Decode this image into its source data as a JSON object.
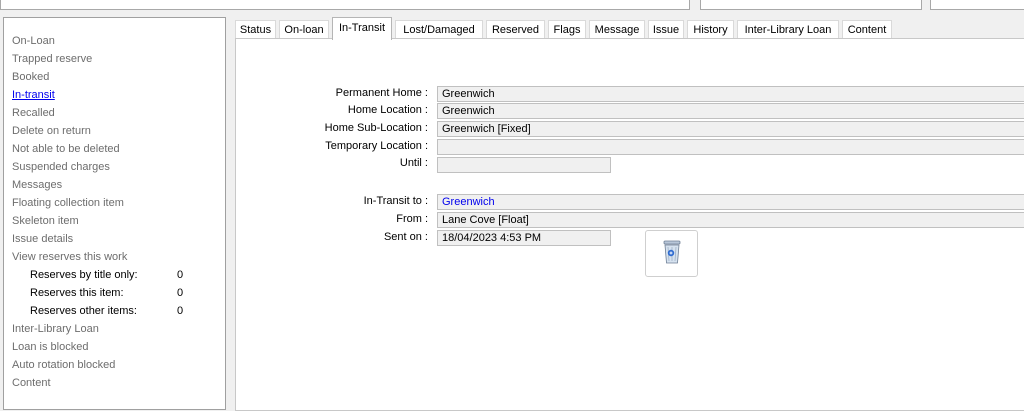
{
  "left_panel": {
    "items": [
      {
        "label": "On-Loan",
        "active": false
      },
      {
        "label": "Trapped reserve",
        "active": false
      },
      {
        "label": "Booked",
        "active": false
      },
      {
        "label": "In-transit",
        "active": true
      },
      {
        "label": "Recalled",
        "active": false
      },
      {
        "label": "Delete on return",
        "active": false
      },
      {
        "label": "Not able to be deleted",
        "active": false
      },
      {
        "label": "Suspended charges",
        "active": false
      },
      {
        "label": "Messages",
        "active": false
      },
      {
        "label": "Floating collection item",
        "active": false
      },
      {
        "label": "Skeleton item",
        "active": false
      },
      {
        "label": "Issue details",
        "active": false
      },
      {
        "label": "View reserves this work",
        "active": false
      }
    ],
    "reserves": [
      {
        "label": "Reserves by title only:",
        "count": "0"
      },
      {
        "label": "Reserves this item:",
        "count": "0"
      },
      {
        "label": "Reserves other items:",
        "count": "0"
      }
    ],
    "items_after": [
      {
        "label": "Inter-Library Loan"
      },
      {
        "label": "Loan is blocked"
      },
      {
        "label": "Auto rotation blocked"
      },
      {
        "label": "Content"
      }
    ]
  },
  "tabs": [
    {
      "label": "Status"
    },
    {
      "label": "On-loan"
    },
    {
      "label": "In-Transit",
      "active": true
    },
    {
      "label": "Lost/Damaged"
    },
    {
      "label": "Reserved"
    },
    {
      "label": "Flags"
    },
    {
      "label": "Message"
    },
    {
      "label": "Issue"
    },
    {
      "label": "History"
    },
    {
      "label": "Inter-Library Loan"
    },
    {
      "label": "Content"
    }
  ],
  "home": {
    "permanent_home_label": "Permanent Home :",
    "permanent_home": "Greenwich",
    "home_location_label": "Home Location :",
    "home_location": "Greenwich",
    "home_sub_location_label": "Home Sub-Location :",
    "home_sub_location": "Greenwich [Fixed]",
    "temporary_location_label": "Temporary Location :",
    "temporary_location": "",
    "until_label": "Until :",
    "until": ""
  },
  "transit": {
    "in_transit_to_label": "In-Transit to :",
    "in_transit_to": "Greenwich",
    "from_label": "From :",
    "from": "Lane Cove [Float]",
    "sent_on_label": "Sent on :",
    "sent_on": "18/04/2023 4:53 PM"
  },
  "icons": {
    "delete": "recycle-bin-icon"
  },
  "colors": {
    "link": "#0000ee",
    "muted_text": "#6d6d6d"
  }
}
